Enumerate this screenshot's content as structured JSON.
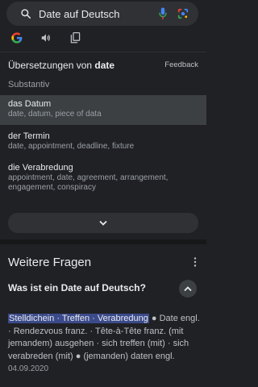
{
  "search": {
    "query": "Date auf Deutsch"
  },
  "icons": {
    "search": "search-icon",
    "mic": "microphone-icon",
    "lens": "lens-icon",
    "google": "google-logo",
    "speaker": "speaker-icon",
    "copy": "copy-icon",
    "expand": "chevron-down-icon",
    "collapse": "chevron-up-icon",
    "more": "more-vert-icon"
  },
  "translations": {
    "title_prefix": "Übersetzungen von",
    "title_word": "date",
    "feedback": "Feedback",
    "part_of_speech": "Substantiv",
    "entries": [
      {
        "word": "das Datum",
        "translations": "date, datum, piece of data"
      },
      {
        "word": "der Termin",
        "translations": "date, appointment, deadline, fixture"
      },
      {
        "word": "die Verabredung",
        "translations": "appointment, date, agreement, arrangement, engagement, conspiracy"
      }
    ]
  },
  "related": {
    "title": "Weitere Fragen",
    "question": "Was ist ein Date auf Deutsch?",
    "answer_highlight": "Stelldichein · Treffen · Verabredung",
    "answer_text": " ● Date engl. · Rendezvous franz. · Tête-à-Tête franz. (mit jemandem) ausgehen · sich treffen (mit) · sich verabreden (mit) ● (jemanden) daten engl. ",
    "answer_date": "04.09.2020"
  },
  "colors": {
    "background": "#202124",
    "surface": "#303134",
    "active_row": "#3c4043",
    "highlight": "#3b4a8a"
  }
}
